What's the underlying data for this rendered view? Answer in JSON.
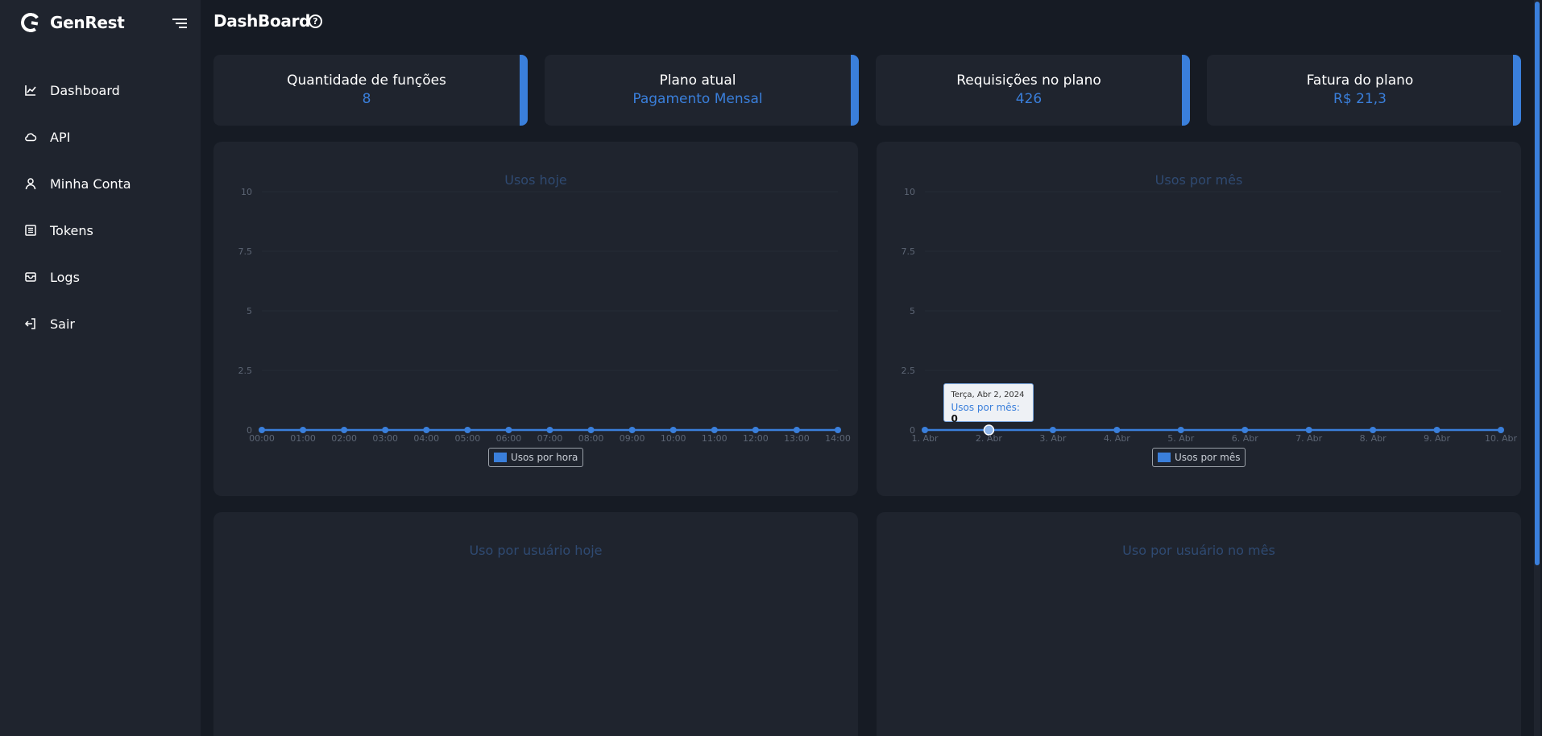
{
  "brand": {
    "name": "GenRest"
  },
  "sidebar": {
    "items": [
      {
        "label": "Dashboard",
        "icon": "chart-line-icon"
      },
      {
        "label": "API",
        "icon": "cloud-icon"
      },
      {
        "label": "Minha Conta",
        "icon": "user-icon"
      },
      {
        "label": "Tokens",
        "icon": "list-icon"
      },
      {
        "label": "Logs",
        "icon": "inbox-icon"
      },
      {
        "label": "Sair",
        "icon": "logout-icon"
      }
    ]
  },
  "header": {
    "title": "DashBoard",
    "help_icon": "help-circle-icon"
  },
  "stats": [
    {
      "title": "Quantidade de funções",
      "value": "8"
    },
    {
      "title": "Plano atual",
      "value": "Pagamento Mensal"
    },
    {
      "title": "Requisições no plano",
      "value": "426"
    },
    {
      "title": "Fatura do plano",
      "value": "R$ 21,3"
    }
  ],
  "colors": {
    "accent": "#3a7fdb",
    "panel": "#1f242e",
    "background": "#161b24"
  },
  "panels": {
    "user_today_title": "Uso por usuário hoje",
    "user_month_title": "Uso por usuário no mês"
  },
  "tooltip": {
    "date": "Terça, Abr 2, 2024",
    "series": "Usos por mês",
    "value": "0"
  },
  "chart_data": [
    {
      "type": "line",
      "title": "Usos hoje",
      "categories": [
        "00:00",
        "01:00",
        "02:00",
        "03:00",
        "04:00",
        "05:00",
        "06:00",
        "07:00",
        "08:00",
        "09:00",
        "10:00",
        "11:00",
        "12:00",
        "13:00",
        "14:00"
      ],
      "series": [
        {
          "name": "Usos por hora",
          "values": [
            0,
            0,
            0,
            0,
            0,
            0,
            0,
            0,
            0,
            0,
            0,
            0,
            0,
            0,
            0
          ]
        }
      ],
      "y_ticks": [
        "0",
        "2.5",
        "5",
        "7.5",
        "10"
      ],
      "ylim": [
        0,
        10
      ],
      "legend": "bottom"
    },
    {
      "type": "line",
      "title": "Usos por mês",
      "categories": [
        "1. Abr",
        "2. Abr",
        "3. Abr",
        "4. Abr",
        "5. Abr",
        "6. Abr",
        "7. Abr",
        "8. Abr",
        "9. Abr",
        "10. Abr"
      ],
      "series": [
        {
          "name": "Usos por mês",
          "values": [
            0,
            0,
            0,
            0,
            0,
            0,
            0,
            0,
            0,
            0
          ]
        }
      ],
      "y_ticks": [
        "0",
        "2.5",
        "5",
        "7.5",
        "10"
      ],
      "ylim": [
        0,
        10
      ],
      "legend": "bottom",
      "highlighted_index": 1
    }
  ]
}
